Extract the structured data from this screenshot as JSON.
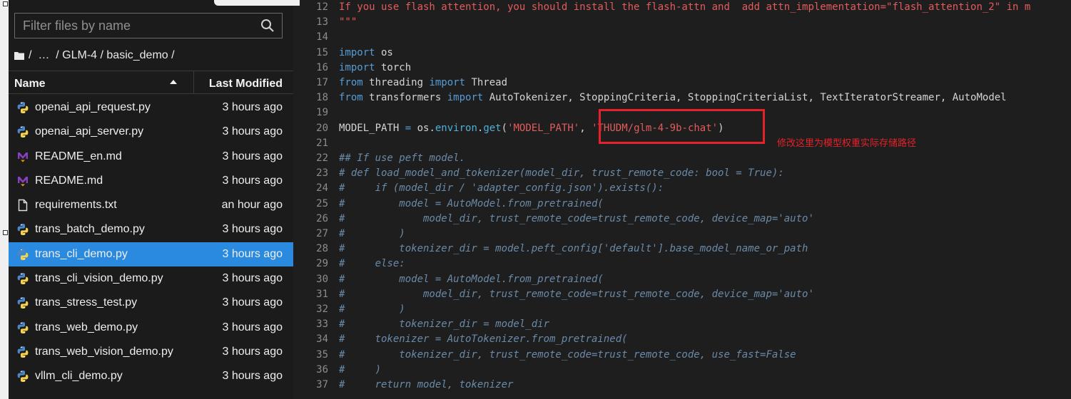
{
  "filter": {
    "placeholder": "Filter files by name"
  },
  "breadcrumb": {
    "root": "/",
    "ellipsis": "…",
    "sep1": "/",
    "folder1": "GLM-4",
    "sep2": "/",
    "folder2": "basic_demo",
    "sep3": "/"
  },
  "columns": {
    "name": "Name",
    "modified": "Last Modified"
  },
  "files": [
    {
      "name": "openai_api_request.py",
      "modified": "3 hours ago",
      "icon": "python-icon"
    },
    {
      "name": "openai_api_server.py",
      "modified": "3 hours ago",
      "icon": "python-icon"
    },
    {
      "name": "README_en.md",
      "modified": "3 hours ago",
      "icon": "markdown-icon"
    },
    {
      "name": "README.md",
      "modified": "3 hours ago",
      "icon": "markdown-icon"
    },
    {
      "name": "requirements.txt",
      "modified": "an hour ago",
      "icon": "text-file-icon"
    },
    {
      "name": "trans_batch_demo.py",
      "modified": "3 hours ago",
      "icon": "python-icon"
    },
    {
      "name": "trans_cli_demo.py",
      "modified": "3 hours ago",
      "icon": "python-icon",
      "selected": true
    },
    {
      "name": "trans_cli_vision_demo.py",
      "modified": "3 hours ago",
      "icon": "python-icon"
    },
    {
      "name": "trans_stress_test.py",
      "modified": "3 hours ago",
      "icon": "python-icon"
    },
    {
      "name": "trans_web_demo.py",
      "modified": "3 hours ago",
      "icon": "python-icon"
    },
    {
      "name": "trans_web_vision_demo.py",
      "modified": "3 hours ago",
      "icon": "python-icon"
    },
    {
      "name": "vllm_cli_demo.py",
      "modified": "3 hours ago",
      "icon": "python-icon"
    }
  ],
  "editor": {
    "annotation": "修改这里为模型权重实际存储路径",
    "lines": [
      {
        "n": "12",
        "t": [
          [
            "str",
            "If you use flash attention, you should install the flash-attn and  add attn_implementation=\"flash_attention_2\" in m"
          ]
        ]
      },
      {
        "n": "13",
        "t": [
          [
            "str",
            "\"\"\""
          ]
        ]
      },
      {
        "n": "14",
        "t": []
      },
      {
        "n": "15",
        "t": [
          [
            "kw",
            "import"
          ],
          [
            "op",
            " os"
          ]
        ]
      },
      {
        "n": "16",
        "t": [
          [
            "kw",
            "import"
          ],
          [
            "op",
            " torch"
          ]
        ]
      },
      {
        "n": "17",
        "t": [
          [
            "kw",
            "from"
          ],
          [
            "op",
            " threading "
          ],
          [
            "kw",
            "import"
          ],
          [
            "op",
            " Thread"
          ]
        ]
      },
      {
        "n": "18",
        "t": [
          [
            "kw",
            "from"
          ],
          [
            "op",
            " transformers "
          ],
          [
            "kw",
            "import"
          ],
          [
            "op",
            " AutoTokenizer, StoppingCriteria, StoppingCriteriaList, TextIteratorStreamer, AutoModel"
          ]
        ]
      },
      {
        "n": "19",
        "t": []
      },
      {
        "n": "20",
        "t": [
          [
            "op",
            "MODEL_PATH "
          ],
          [
            "kw",
            "="
          ],
          [
            "op",
            " os."
          ],
          [
            "fn",
            "environ"
          ],
          [
            "op",
            "."
          ],
          [
            "fn",
            "get"
          ],
          [
            "op",
            "("
          ],
          [
            "str",
            "'MODEL_PATH'"
          ],
          [
            "op",
            ", "
          ],
          [
            "str",
            "'THUDM/glm-4-9b-chat'"
          ],
          [
            "op",
            ")"
          ]
        ]
      },
      {
        "n": "21",
        "t": []
      },
      {
        "n": "22",
        "t": [
          [
            "cm",
            "## If use peft model."
          ]
        ]
      },
      {
        "n": "23",
        "t": [
          [
            "cm",
            "# def load_model_and_tokenizer(model_dir, trust_remote_code: bool = True):"
          ]
        ]
      },
      {
        "n": "24",
        "t": [
          [
            "cm",
            "#     if (model_dir / 'adapter_config.json').exists():"
          ]
        ]
      },
      {
        "n": "25",
        "t": [
          [
            "cm",
            "#         model = AutoModel.from_pretrained("
          ]
        ]
      },
      {
        "n": "26",
        "t": [
          [
            "cm",
            "#             model_dir, trust_remote_code=trust_remote_code, device_map='auto'"
          ]
        ]
      },
      {
        "n": "27",
        "t": [
          [
            "cm",
            "#         )"
          ]
        ]
      },
      {
        "n": "28",
        "t": [
          [
            "cm",
            "#         tokenizer_dir = model.peft_config['default'].base_model_name_or_path"
          ]
        ]
      },
      {
        "n": "29",
        "t": [
          [
            "cm",
            "#     else:"
          ]
        ]
      },
      {
        "n": "30",
        "t": [
          [
            "cm",
            "#         model = AutoModel.from_pretrained("
          ]
        ]
      },
      {
        "n": "31",
        "t": [
          [
            "cm",
            "#             model_dir, trust_remote_code=trust_remote_code, device_map='auto'"
          ]
        ]
      },
      {
        "n": "32",
        "t": [
          [
            "cm",
            "#         )"
          ]
        ]
      },
      {
        "n": "33",
        "t": [
          [
            "cm",
            "#         tokenizer_dir = model_dir"
          ]
        ]
      },
      {
        "n": "34",
        "t": [
          [
            "cm",
            "#     tokenizer = AutoTokenizer.from_pretrained("
          ]
        ]
      },
      {
        "n": "35",
        "t": [
          [
            "cm",
            "#         tokenizer_dir, trust_remote_code=trust_remote_code, use_fast=False"
          ]
        ]
      },
      {
        "n": "36",
        "t": [
          [
            "cm",
            "#     )"
          ]
        ]
      },
      {
        "n": "37",
        "t": [
          [
            "cm",
            "#     return model, tokenizer"
          ]
        ]
      }
    ]
  },
  "colors": {
    "selection": "#2a8adf",
    "highlight_box": "#e5222a",
    "keyword": "#569cd6",
    "string": "#e25c5c",
    "comment": "#6a8aa8"
  }
}
